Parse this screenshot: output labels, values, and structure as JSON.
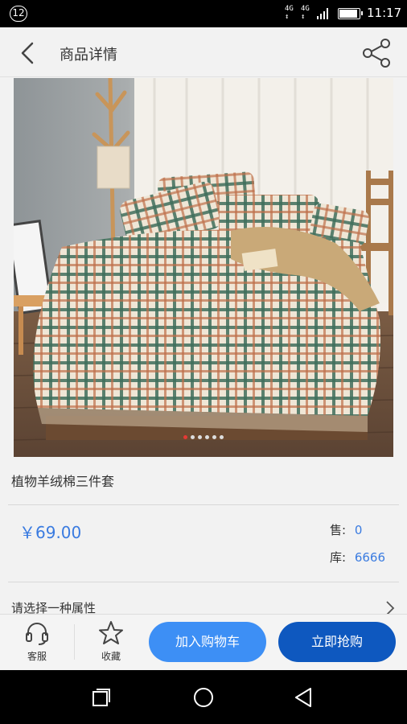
{
  "status_bar": {
    "notification_count": "12",
    "network_1": "4G",
    "network_2": "4G",
    "time": "11:17",
    "battery_level": 0.85
  },
  "header": {
    "title": "商品详情",
    "back_icon": "chevron-left-icon",
    "share_icon": "share-icon"
  },
  "gallery": {
    "image_count": 6,
    "active_index": 0
  },
  "product": {
    "name": "植物羊绒棉三件套",
    "price": "￥69.00",
    "sold_label": "售:",
    "sold_value": "0",
    "stock_label": "库:",
    "stock_value": "6666",
    "attribute_prompt": "请选择一种属性"
  },
  "bottom_bar": {
    "service_label": "客服",
    "favorite_label": "收藏",
    "add_to_cart_label": "加入购物车",
    "buy_now_label": "立即抢购"
  },
  "colors": {
    "accent_blue": "#3a7be0",
    "cart_button": "#3d8ff5",
    "buy_button": "#0e58bf"
  }
}
